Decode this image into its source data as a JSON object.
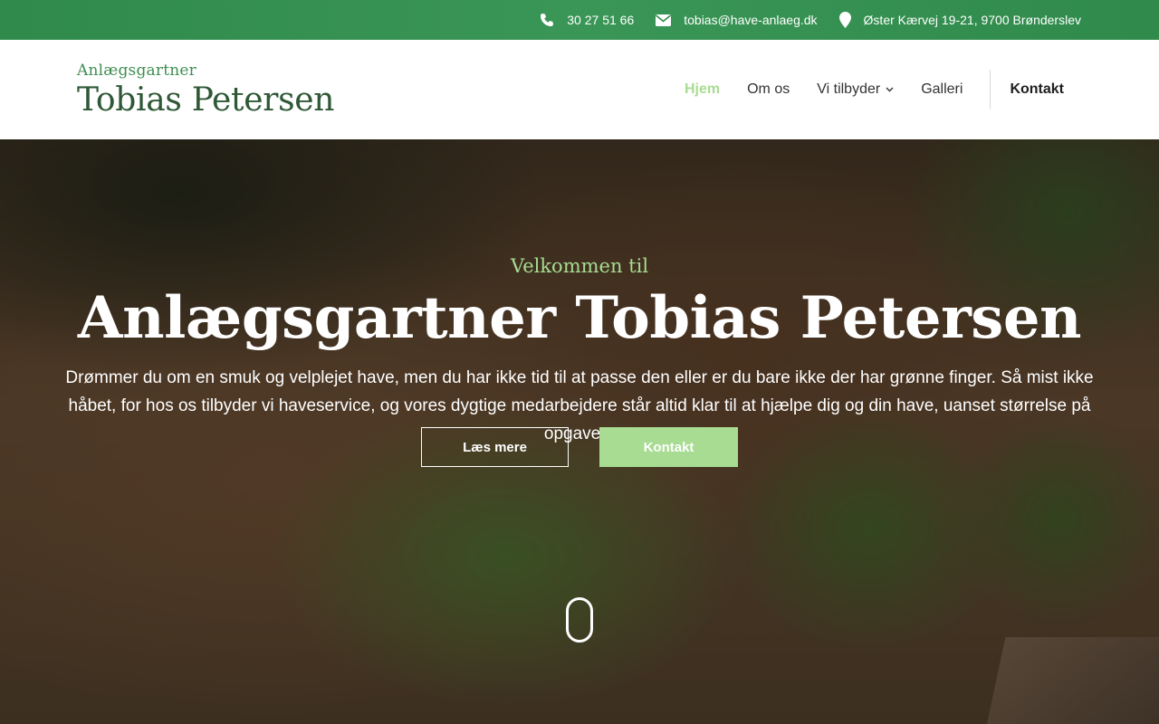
{
  "topbar": {
    "phone": "30 27 51 66",
    "email": "tobias@have-anlaeg.dk",
    "address": "Øster Kærvej 19-21, 9700 Brønderslev",
    "icons": [
      "phone-icon",
      "envelope-icon",
      "map-pin-icon"
    ],
    "background": "#2f8a4b"
  },
  "header": {
    "logo_sub": "Anlægsgartner",
    "logo_main": "Tobias Petersen",
    "nav": {
      "home": "Hjem",
      "about": "Om os",
      "services": "Vi tilbyder",
      "gallery": "Galleri",
      "contact": "Kontakt"
    }
  },
  "hero": {
    "kicker": "Velkommen til",
    "title": "Anlægsgartner Tobias Petersen",
    "text": "Drømmer du om en smuk og velplejet have, men du har ikke tid til at passe den eller er du bare ikke der har grønne finger. Så mist ikke håbet, for hos os tilbyder vi haveservice, og vores dygtige medarbejdere står altid klar til at hjælpe dig og din have, uanset størrelse på opgaven.",
    "read_more": "Læs mere",
    "contact": "Kontakt"
  },
  "colors": {
    "accent": "#a8dc92",
    "brand_green": "#3e8e50",
    "logo_dark": "#2e5836"
  }
}
